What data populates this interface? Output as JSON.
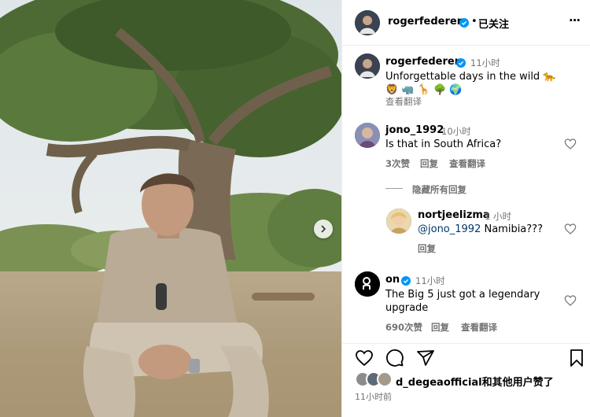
{
  "header": {
    "username": "rogerfederer",
    "dot": "•",
    "follow_status": "已关注",
    "more": "···"
  },
  "caption": {
    "username": "rogerfederer",
    "time": "11小时",
    "text": "Unforgettable days in the wild 🐆",
    "emojis": "🦁 🦏 🦒 🌳 🌍",
    "translate": "查看翻译"
  },
  "comments": [
    {
      "username": "jono_1992",
      "time": "10小时",
      "text": "Is that in South Africa?",
      "likes": "3次赞",
      "reply": "回复",
      "translate": "查看翻译",
      "hide_replies": "隐藏所有回复"
    },
    {
      "username": "nortjeelizma",
      "time": "1 小时",
      "mention": "@jono_1992",
      "text": " Namibia???",
      "reply": "回复"
    },
    {
      "username": "on",
      "time": "11小时",
      "text_line1": "The Big 5 just got a legendary",
      "text_line2": "upgrade",
      "likes": "690次赞",
      "reply": "回复",
      "translate": "查看翻译"
    }
  ],
  "likes": {
    "user": "d_degeaofficial",
    "suffix": "和其他用户赞了",
    "time": "11小时前"
  },
  "colors": {
    "verified": "#0095f6",
    "muted": "#737373",
    "border": "#efefef"
  }
}
